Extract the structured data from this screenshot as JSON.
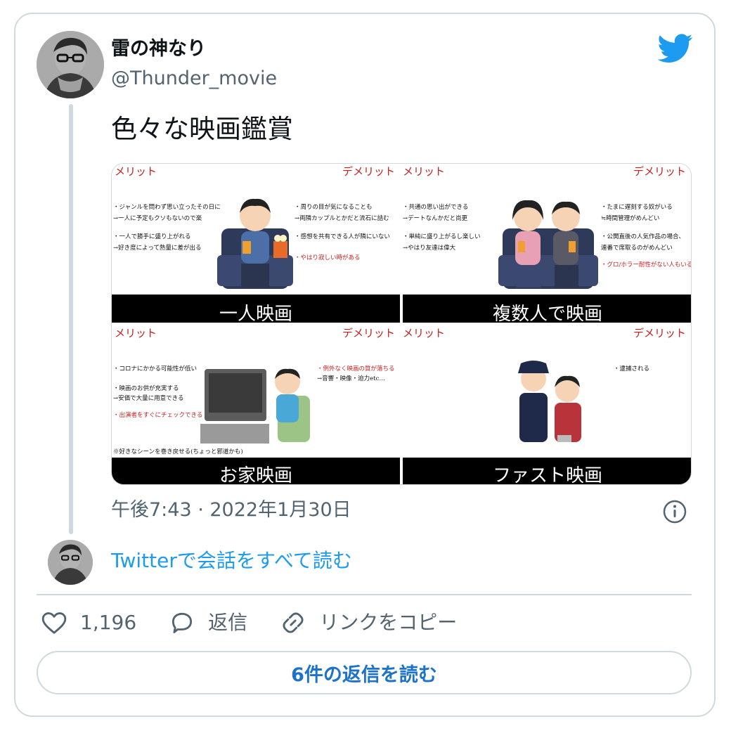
{
  "author": {
    "display_name": "雷の神なり",
    "handle": "@Thunder_movie"
  },
  "tweet": {
    "text": "色々な映画鑑賞",
    "timestamp": "午後7:43 · 2022年1月30日"
  },
  "media": {
    "panels": [
      {
        "merit_label": "メリット",
        "demerit_label": "デメリット",
        "title": "一人映画",
        "merits": [
          "・ジャンルを問わず思い立ったその日に",
          "→一人に予定もクソもないので楽",
          "・一人で勝手に盛り上がれる",
          "→好き度によって熱量に差が出る"
        ],
        "demerits": [
          "・周りの目が気になることも",
          "→両隣カップルとかだと流石に詰む",
          "・感想を共有できる人が隣にいない",
          "・やはり寂しい時がある"
        ]
      },
      {
        "merit_label": "メリット",
        "demerit_label": "デメリット",
        "title": "複数人で映画",
        "merits": [
          "・共通の思い出ができる",
          "→デートなんかだと尚更",
          "・単純に盛り上がるし楽しい",
          "→やはり友達は偉大"
        ],
        "demerits": [
          "・たまに遅刻する奴がいる",
          "≒時間管理がめんどい",
          "・公開直後の人気作品の場合、",
          "連番で席取るのがめんどい",
          "・グロ/ホラー耐性がない人もいる"
        ]
      },
      {
        "merit_label": "メリット",
        "demerit_label": "デメリット",
        "title": "お家映画",
        "merits": [
          "・コロナにかかる可能性が低い",
          "・映画のお供が充実する",
          "→安価で大量に用意できる",
          "・出演者をすぐにチェックできる",
          "※好きなシーンを巻き戻せる(ちょっと邪道かも)"
        ],
        "demerits": [
          "・例外なく映画の質が落ちる",
          "→音響・映像・迫力etc…"
        ]
      },
      {
        "merit_label": "メリット",
        "demerit_label": "デメリット",
        "title": "ファスト映画",
        "merits": [],
        "demerits": [
          "・逮捕される"
        ]
      }
    ]
  },
  "conversation": {
    "read_all_label": "Twitterで会話をすべて読む"
  },
  "actions": {
    "likes_count": "1,196",
    "reply_label": "返信",
    "copy_link_label": "リンクをコピー"
  },
  "read_replies_label": "6件の返信を読む",
  "colors": {
    "accent": "#1d9bf0",
    "secondary_text": "#536471",
    "border": "#cfd9de",
    "panel_red": "#c41e1e"
  },
  "icons": {
    "brand": "twitter-bird-icon",
    "info": "info-icon",
    "like": "heart-icon",
    "reply": "reply-bubble-icon",
    "copy_link": "link-icon"
  }
}
